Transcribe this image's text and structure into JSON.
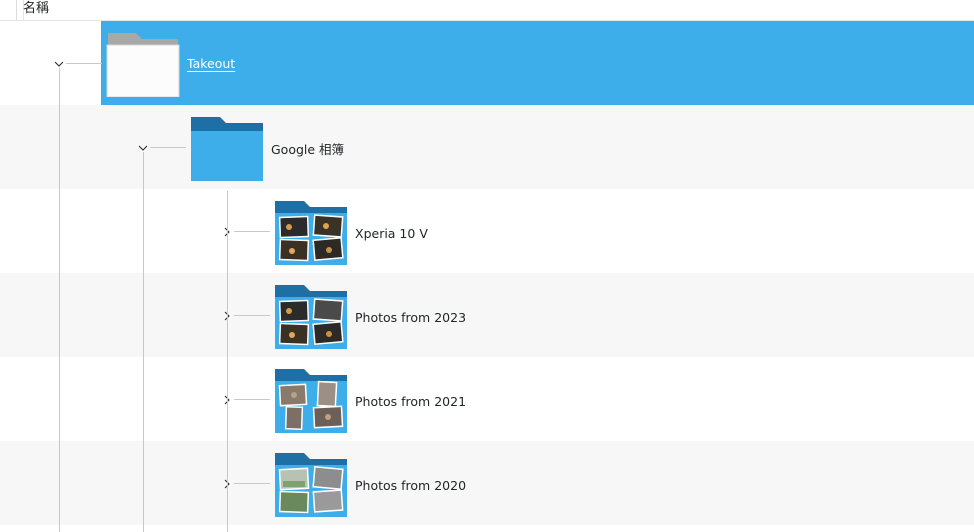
{
  "header": {
    "name_column": "名稱"
  },
  "tree": [
    {
      "label": "Takeout",
      "expanded": true,
      "selected": true,
      "folder_style": "white-open"
    },
    {
      "label": "Google 相簿",
      "expanded": true,
      "selected": false,
      "folder_style": "blue"
    },
    {
      "label": "Xperia 10 V",
      "expanded": false,
      "selected": false,
      "folder_style": "blue-preview"
    },
    {
      "label": "Photos from 2023",
      "expanded": false,
      "selected": false,
      "folder_style": "blue-preview"
    },
    {
      "label": "Photos from 2021",
      "expanded": false,
      "selected": false,
      "folder_style": "blue-preview"
    },
    {
      "label": "Photos from 2020",
      "expanded": false,
      "selected": false,
      "folder_style": "blue-preview"
    }
  ],
  "colors": {
    "selection": "#3daee9",
    "folder_blue": "#3daee9",
    "folder_tab_blue": "#1d6fa5",
    "folder_white": "#fcfcfc",
    "folder_tab_grey": "#a8a8a8"
  },
  "icons": {
    "expanded": "chevron-down-icon",
    "collapsed": "chevron-right-icon",
    "folder": "folder-icon"
  }
}
